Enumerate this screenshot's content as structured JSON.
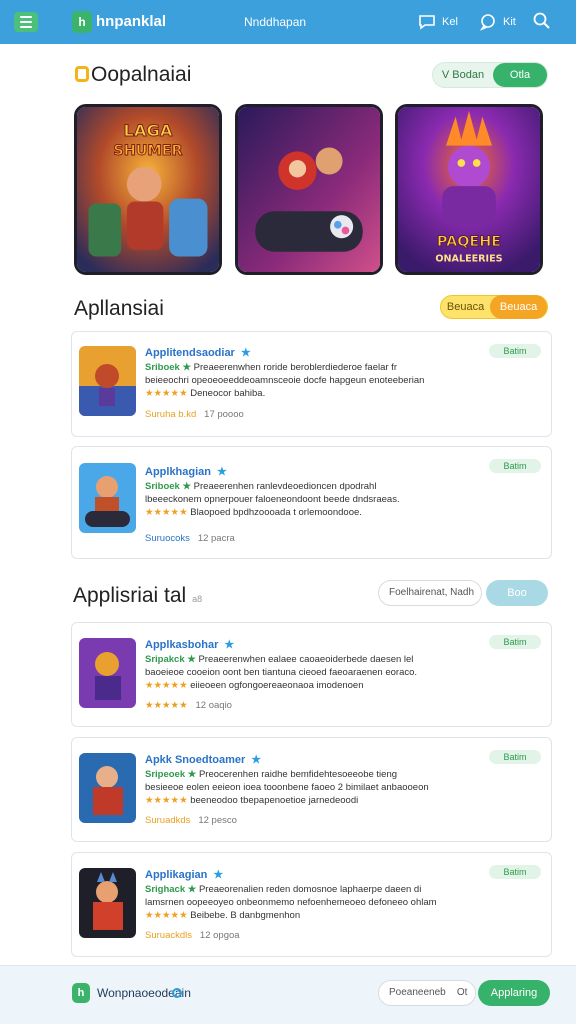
{
  "header": {
    "brand_mark": "h",
    "brand_name": "hnpanklal",
    "center_label": "Nnddhapan",
    "action1_label": "Kel",
    "action2_label": "Kit"
  },
  "featured": {
    "title": "Oopalnaiai",
    "toggle_a": "Bodan",
    "toggle_a_prefix": "V",
    "toggle_b": "Otla",
    "cards": [
      {
        "art_label1": "LAGA",
        "art_label2": "SHUMER"
      },
      {
        "art_label1": "",
        "art_label2": ""
      },
      {
        "art_label1": "PAQEHE",
        "art_label2": "ONALEERIES"
      }
    ]
  },
  "section2": {
    "title": "Apllansiai",
    "toggle_a": "Beuaca",
    "toggle_b": "Beuaca",
    "apps": [
      {
        "title": "Applitendsaodiar",
        "line1_green": "Sriboek",
        "line1_rest": "Preaeerenwhen roride beroblerdiederoe faelar fr",
        "line2": "beieeochri opeoeoeeddeoamnsceoie docfe hapgeun enoteeberian",
        "line3_rest": "Deneocor bahiba.",
        "meta_colored": "Suruha b.kd",
        "meta_rest": "17 poooo",
        "badge": "Batim"
      },
      {
        "title": "Applkhagian",
        "line1_green": "Sriboek",
        "line1_rest": "Preaeerenhen ranlevdeoedioncen dpodrahl",
        "line2": "lbeeeckonem opnerpouer faloeneondoont beede dndsraeas.",
        "line3_rest": "Blaopoed bpdhzoooada t orlemoondooe.",
        "meta_colored": "Suruocoks",
        "meta_rest": "12 pacra",
        "badge": "Batim"
      }
    ]
  },
  "section3": {
    "title": "Applisriai tal",
    "title_suffix": "a8",
    "filter_placeholder": "Foelhairenat, Nadh",
    "filter_button": "Boo",
    "apps": [
      {
        "title": "Applkasbohar",
        "line1_green": "Sripakck",
        "line1_rest": "Preaeerenwhen ealaee caoaeoiderbede daesen lel",
        "line2": "baoeieoe cooeion oont ben tiantuna cieoed faeoaraenen eoraco.",
        "line3_rest": "eiieoeen ogfongoereaeonaoa imodenoen",
        "meta_colored": "",
        "meta_rest": "12 oaqio",
        "badge": "Batim"
      },
      {
        "title": "Apkk Snoedtoamer",
        "line1_green": "Sripeoek",
        "line1_rest": "Preocerenhen raidhe bemfidehtesoeeobe tieng",
        "line2": "besieeoe eolen eeieon ioea tooonbene faoeo 2 bimilaet anbaooeon",
        "line3_rest": "beeneodoo tbepapenoetioe jarnedeoodi",
        "meta_colored": "Suruadkds",
        "meta_rest": "12 pesco",
        "badge": "Batim"
      },
      {
        "title": "Applikagian",
        "line1_green": "Srighack",
        "line1_rest": "Preaeorenalien reden domosnoe laphaerpe daeen di",
        "line2": "lamsrnen oopeeoyeo onbeonmemo nefoenhemeoeo defoneeo ohlam",
        "line3_rest": "Beibebe. B danbgmenhon",
        "meta_colored": "Suruackdls",
        "meta_rest": "12 opgoa",
        "badge": "Batim"
      }
    ]
  },
  "footer": {
    "logo_mark": "h",
    "brand_name": "Wonpnaoeodeain",
    "input_text": "Poeaneeneb",
    "input_suffix": "Ot",
    "button": "Applaring"
  },
  "colors": {
    "topbar": "#3ba0dc",
    "accent_green": "#36b26a",
    "accent_orange": "#f5a524",
    "link_blue": "#2a73c8"
  }
}
